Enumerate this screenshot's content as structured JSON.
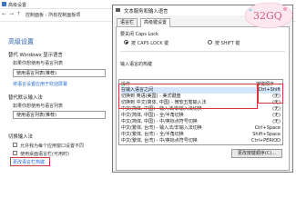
{
  "background": {
    "window_title": "高级设置",
    "breadcrumb": [
      "控制面板",
      "所有控制面板项"
    ],
    "page_title": "高级设置",
    "override_display": {
      "heading": "替代 Windows 显示语言",
      "desc": "如果你想使用与语言列表",
      "dropdown_value": "使用语言列表(推荐)",
      "link": "将语言设置应用于欢迎屏幕"
    },
    "override_input": {
      "heading": "替代默认输入法",
      "desc": "如果你想使用与语言列表",
      "dropdown_value": "使用语言列表(推荐)"
    },
    "switch_input": {
      "heading": "切换输入法",
      "cb1": "允许我为每个应用窗口设置不同",
      "cb2": "使用桌面语言栏(可用时)",
      "link": "更改语言栏热键"
    }
  },
  "dialog": {
    "title": "文本服务和输入语言",
    "close_icon": "close",
    "tabs": [
      "语言栏",
      "高级键设置"
    ],
    "capslock": {
      "heading": "要关闭 Caps Lock",
      "option1": "按 CAPS LOCK 键",
      "option2": "按 SHIFT 键"
    },
    "hotkeys": {
      "heading": "输入语言的热键",
      "col_action": "操作",
      "col_key": "按键顺序",
      "rows": [
        {
          "action": "在输入语言之间",
          "key": "Ctrl+Shift"
        },
        {
          "action": "切换到 英语(美国) - 美式键盘",
          "key": "(无)"
        },
        {
          "action": "切换到 中文(简体, 中国) - 微软五笔输入法",
          "key": "(无)"
        },
        {
          "action": "中文(简体, 中国) - 输入法/非输入法切换",
          "key": "(无)"
        },
        {
          "action": "中文(简体, 中国) - 全/半角切换",
          "key": "(无)"
        },
        {
          "action": "中文(简体, 中国) - 中/英标点符号切换",
          "key": "(无)"
        },
        {
          "action": "中文(繁体, 台湾) - 输入法/非输入法切换",
          "key": "Ctrl+Space"
        },
        {
          "action": "中文(繁体, 台湾) - 全/半角切换",
          "key": "Shift+Space"
        },
        {
          "action": "中文(繁体, 台湾) - 中/英标点符号切换",
          "key": "Ctrl+PERIOD"
        }
      ],
      "change_button": "更改按键顺序(C)..."
    }
  },
  "highlight_color": "#d23a3a",
  "selected_row_color": "#d4e6fb",
  "logo_text": "32GQ"
}
